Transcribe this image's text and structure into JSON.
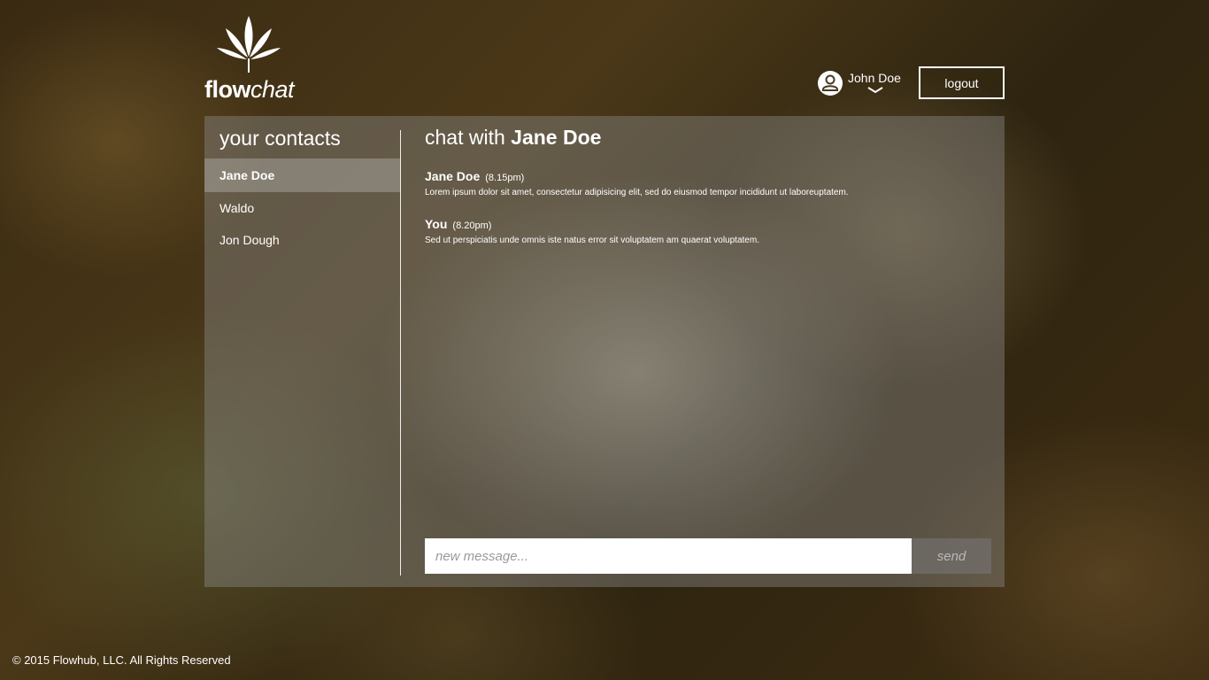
{
  "brand": {
    "logo_icon": "cannabis-leaf-icon",
    "name_bold": "flow",
    "name_italic": "chat"
  },
  "user": {
    "name": "John Doe",
    "avatar_icon": "user-avatar-icon",
    "menu_icon": "chevron-down-icon"
  },
  "header": {
    "logout_label": "logout"
  },
  "contacts": {
    "title": "your contacts",
    "items": [
      {
        "name": "Jane Doe",
        "active": true
      },
      {
        "name": "Waldo",
        "active": false
      },
      {
        "name": "Jon Dough",
        "active": false
      }
    ]
  },
  "chat": {
    "title_prefix": "chat with",
    "contact_name": "Jane Doe",
    "messages": [
      {
        "sender": "Jane Doe",
        "time": "(8.15pm)",
        "text": "Lorem ipsum dolor sit amet, consectetur adipisicing elit, sed do eiusmod tempor incididunt ut laboreuptatem."
      },
      {
        "sender": "You",
        "time": "(8.20pm)",
        "text": "Sed ut perspiciatis unde omnis iste natus error sit voluptatem am quaerat voluptatem."
      }
    ],
    "input_placeholder": "new message...",
    "send_label": "send"
  },
  "footer": {
    "copyright": "© 2015 Flowhub, LLC. All Rights Reserved"
  },
  "colors": {
    "panel": "#8c8c8c",
    "text": "#ffffff",
    "send_bg": "#787878"
  }
}
